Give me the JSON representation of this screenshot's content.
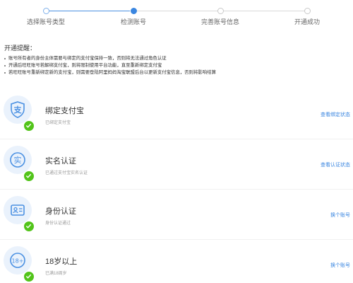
{
  "steps": [
    {
      "label": "选择账号类型",
      "state": "done"
    },
    {
      "label": "检测账号",
      "state": "active"
    },
    {
      "label": "完善账号信息",
      "state": "todo"
    },
    {
      "label": "开通成功",
      "state": "todo"
    }
  ],
  "notice": {
    "title": "开通提醒：",
    "lines": [
      "账号所有者的身份主体需要与绑定的支付宝保持一致，否则将无法通过角色认证",
      "开通后旺旺账号若解绑支付宝，则将限制使用平台功能，直至重新绑定支付宝",
      "若旺旺账号重新绑定新的支付宝，则需要登陆阿里妈妈淘宝联盟后台以更新支付宝信息，否则将影响结算"
    ]
  },
  "items": [
    {
      "icon": "alipay-icon",
      "title": "绑定支付宝",
      "desc": "已绑定支付宝",
      "action": "查看绑定状态",
      "status": "passed"
    },
    {
      "icon": "real-name-icon",
      "title": "实名认证",
      "desc": "已通过支付宝实名认证",
      "action": "查看认证状态",
      "status": "passed"
    },
    {
      "icon": "id-card-icon",
      "title": "身份认证",
      "desc": "身份认证通过",
      "action": "换个账号",
      "status": "passed"
    },
    {
      "icon": "age-18-icon",
      "title": "18岁以上",
      "desc": "已满18周岁",
      "action": "换个账号",
      "status": "passed"
    }
  ],
  "colors": {
    "accent": "#3a86e0",
    "success": "#52c41a",
    "icon_bg": "#eaf2fc"
  }
}
